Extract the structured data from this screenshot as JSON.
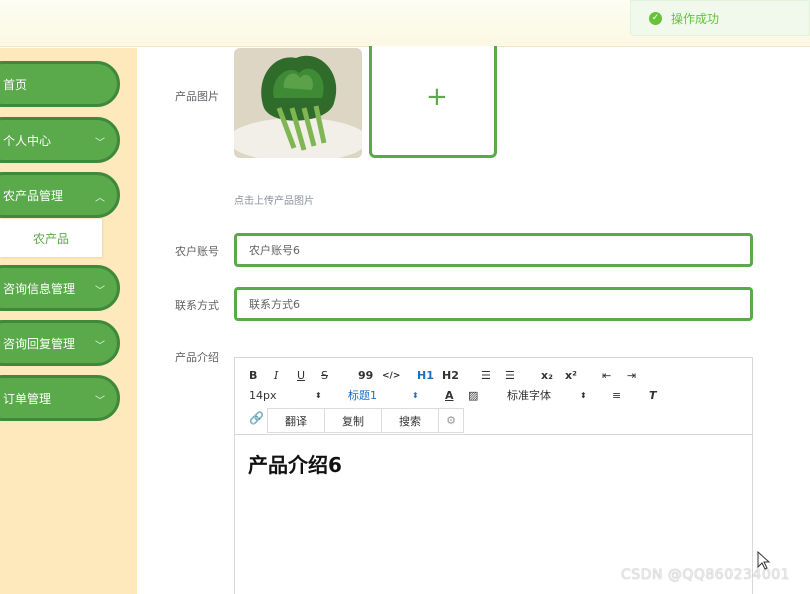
{
  "toast": {
    "message": "操作成功"
  },
  "sidebar": {
    "items": [
      {
        "label": "首页",
        "has_children": false
      },
      {
        "label": "个人中心",
        "has_children": true
      },
      {
        "label": "农产品管理",
        "has_children": true
      },
      {
        "label": "咨询信息管理",
        "has_children": true
      },
      {
        "label": "咨询回复管理",
        "has_children": true
      },
      {
        "label": "订单管理",
        "has_children": true
      }
    ],
    "submenu": {
      "label": "农产品"
    },
    "accent": "#5aa94b"
  },
  "form": {
    "image_label": "产品图片",
    "upload_hint": "点击上传产品图片",
    "account_label": "农户账号",
    "account_value": "农户账号6",
    "contact_label": "联系方式",
    "contact_value": "联系方式6",
    "intro_label": "产品介绍"
  },
  "editor": {
    "toolbar": {
      "bold": "B",
      "italic": "I",
      "underline": "U",
      "strike": "S",
      "quote": "99",
      "code": "</>",
      "h1": "H1",
      "h2": "H2",
      "sub": "x₂",
      "sup": "x²",
      "font_size": "14px",
      "heading": "标题1",
      "font_family": "标准字体",
      "translate": "翻译",
      "copy": "复制",
      "search": "搜索"
    },
    "content_heading": "产品介绍6"
  },
  "watermark": "CSDN @QQ860234001"
}
